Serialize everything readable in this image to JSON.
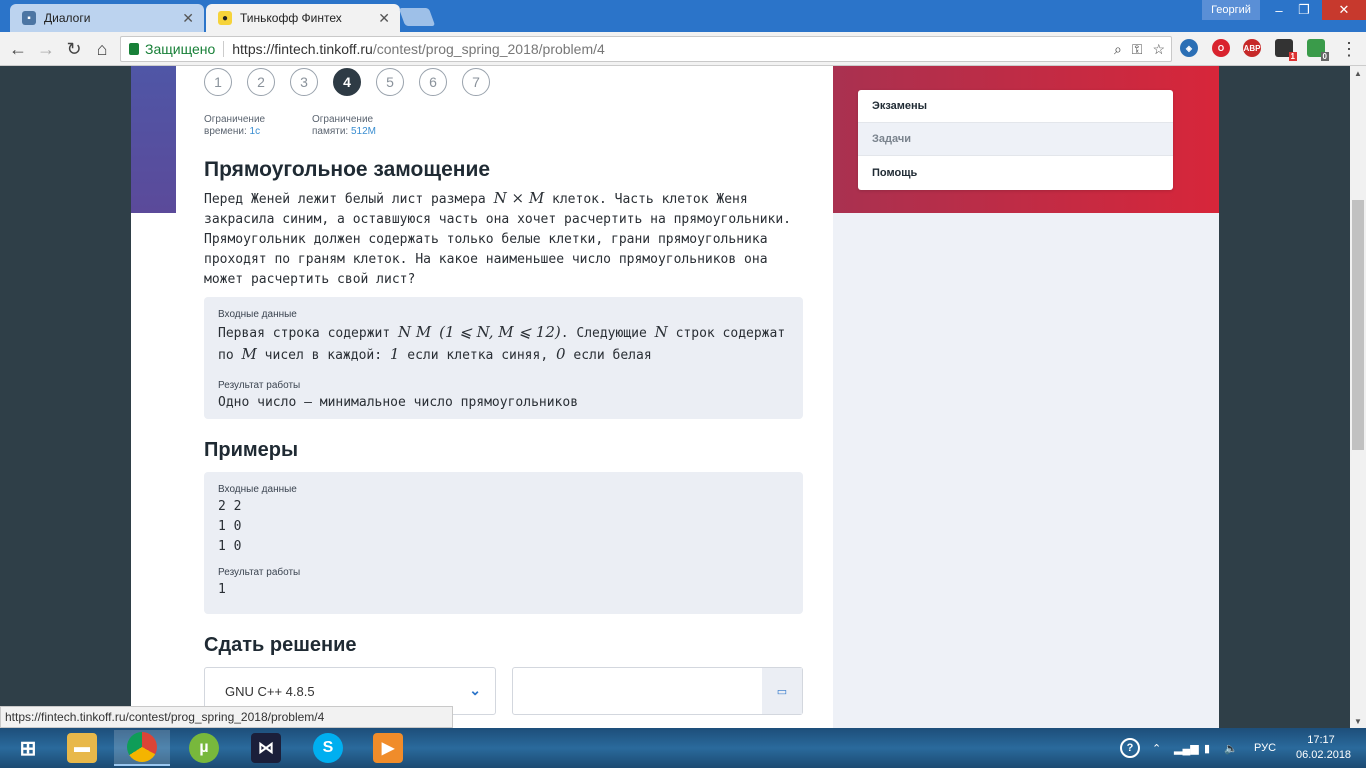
{
  "browser": {
    "tabs": [
      {
        "title": "Диалоги",
        "active": false
      },
      {
        "title": "Тинькофф Финтех",
        "active": true
      }
    ],
    "user": "Георгий",
    "secure_label": "Защищено",
    "url_scheme_host": "https://fintech.tinkoff.ru",
    "url_path": "/contest/prog_spring_2018/problem/4",
    "status_url": "https://fintech.tinkoff.ru/contest/prog_spring_2018/problem/4",
    "extensions": {
      "abp": "ABP",
      "badge1": "1",
      "badge2": "0"
    }
  },
  "problem": {
    "numbers": [
      "1",
      "2",
      "3",
      "4",
      "5",
      "6",
      "7"
    ],
    "active_number": "4",
    "time_limit_label_1": "Ограничение",
    "time_limit_label_2": "времени:",
    "time_limit_value": "1с",
    "memory_limit_label_1": "Ограничение",
    "memory_limit_label_2": "памяти:",
    "memory_limit_value": "512M",
    "title": "Прямоугольное замощение",
    "statement": {
      "p1": "Перед Женей лежит белый лист размера ",
      "math1": "N × M",
      "p2": " клеток. Часть клеток Женя закрасила синим, а оставшуюся часть она хочет расчертить на прямоугольники. Прямоугольник должен содержать только белые клетки, грани прямоугольника проходят по граням клеток. На какое наименьшее число прямоугольников она может расчертить свой лист?"
    },
    "input_label": "Входные данные",
    "input_text_1": "Первая строка содержит ",
    "input_math_1": "N M",
    "input_math_2": "(1 ⩽ N, M ⩽ 12)",
    "input_text_2": ". Следующие ",
    "input_math_3": "N",
    "input_text_3": " строк содержат",
    "input_text_4": "по ",
    "input_math_4": "M",
    "input_text_5": " чисел в каждой: ",
    "input_math_5": "1",
    "input_text_6": " если клетка синяя, ",
    "input_math_6": "0",
    "input_text_7": " если белая",
    "output_label": "Результат работы",
    "output_text": "Одно число — минимальное число прямоугольников",
    "examples_title": "Примеры",
    "example": {
      "input_label": "Входные данные",
      "input_lines": [
        "2 2",
        "1 0",
        "1 0"
      ],
      "output_label": "Результат работы",
      "output": "1"
    },
    "submit_title": "Сдать решение",
    "compiler": "GNU C++ 4.8.5"
  },
  "sidebar_menu": [
    "Экзамены",
    "Задачи",
    "Помощь"
  ],
  "taskbar": {
    "lang": "РУС",
    "time": "17:17",
    "date": "06.02.2018"
  }
}
